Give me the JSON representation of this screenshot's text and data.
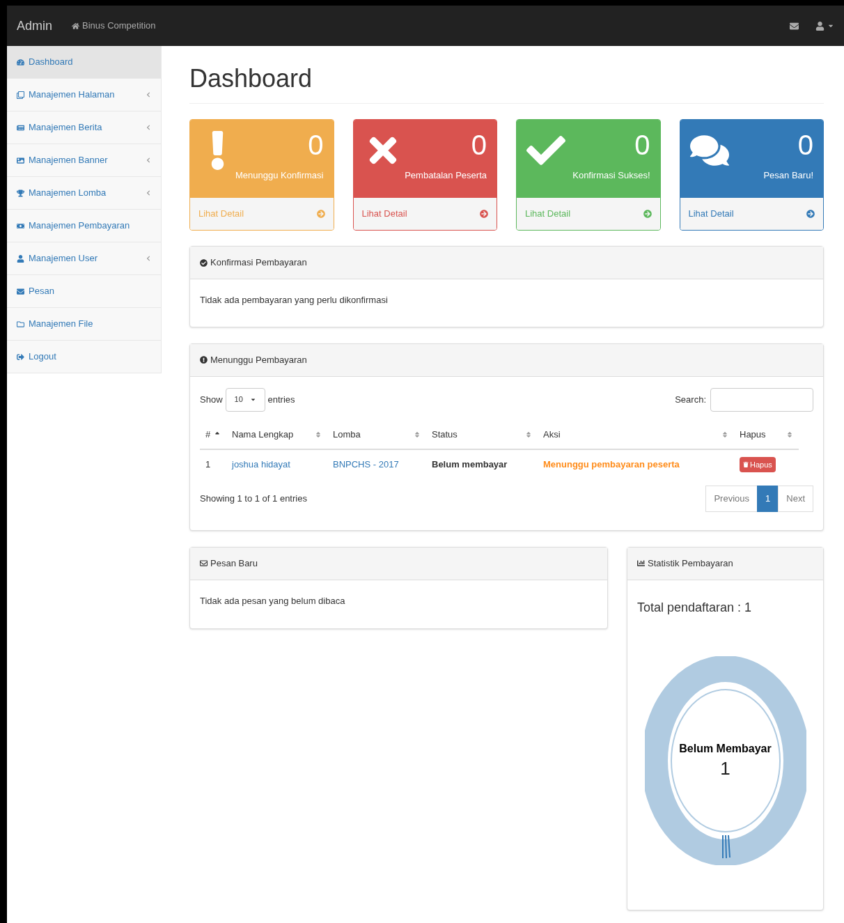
{
  "navbar": {
    "brand": "Admin",
    "link": "Binus Competition"
  },
  "sidebar": {
    "items": [
      {
        "label": "Dashboard",
        "selected": true,
        "submenu": false
      },
      {
        "label": "Manajemen Halaman",
        "selected": false,
        "submenu": true
      },
      {
        "label": "Manajemen Berita",
        "selected": false,
        "submenu": true
      },
      {
        "label": "Manajemen Banner",
        "selected": false,
        "submenu": true
      },
      {
        "label": "Manajemen Lomba",
        "selected": false,
        "submenu": true
      },
      {
        "label": "Manajemen Pembayaran",
        "selected": false,
        "submenu": false
      },
      {
        "label": "Manajemen User",
        "selected": false,
        "submenu": true
      },
      {
        "label": "Pesan",
        "selected": false,
        "submenu": false
      },
      {
        "label": "Manajemen File",
        "selected": false,
        "submenu": false
      },
      {
        "label": "Logout",
        "selected": false,
        "submenu": false
      }
    ]
  },
  "page_title": "Dashboard",
  "stat_cards": [
    {
      "kind": "warning",
      "count": "0",
      "label": "Menunggu Konfirmasi",
      "link": "Lihat Detail"
    },
    {
      "kind": "danger",
      "count": "0",
      "label": "Pembatalan Peserta",
      "link": "Lihat Detail"
    },
    {
      "kind": "success",
      "count": "0",
      "label": "Konfirmasi Sukses!",
      "link": "Lihat Detail"
    },
    {
      "kind": "primary",
      "count": "0",
      "label": "Pesan Baru!",
      "link": "Lihat Detail"
    }
  ],
  "konfirmasi_panel": {
    "title": "Konfirmasi Pembayaran",
    "message": "Tidak ada pembayaran yang perlu dikonfirmasi"
  },
  "menunggu_panel": {
    "title": "Menunggu Pembayaran",
    "show_label": "Show",
    "page_size": "10",
    "entries_label": "entries",
    "search_label": "Search:",
    "columns": [
      {
        "label": "#",
        "sorted": true
      },
      {
        "label": "Nama Lengkap",
        "sorted": false
      },
      {
        "label": "Lomba",
        "sorted": false
      },
      {
        "label": "Status",
        "sorted": false
      },
      {
        "label": "Aksi",
        "sorted": false
      },
      {
        "label": "Hapus",
        "sorted": false
      }
    ],
    "rows": [
      {
        "no": "1",
        "name": "joshua hidayat",
        "lomba": "BNPCHS - 2017",
        "status": "Belum membayar",
        "aksi": "Menunggu pembayaran peserta",
        "hapus": "Hapus"
      }
    ],
    "info": "Showing 1 to 1 of 1 entries",
    "pagination": [
      {
        "label": "Previous",
        "selected": false
      },
      {
        "label": "1",
        "selected": true
      },
      {
        "label": "Next",
        "selected": false
      }
    ]
  },
  "pesan_panel": {
    "title": "Pesan Baru",
    "message": "Tidak ada pesan yang belum dibaca"
  },
  "statistik_panel": {
    "title": "Statistik Pembayaran",
    "total": "Total pendaftaran : 1",
    "donut_label": "Belum Membayar",
    "donut_value": "1"
  }
}
